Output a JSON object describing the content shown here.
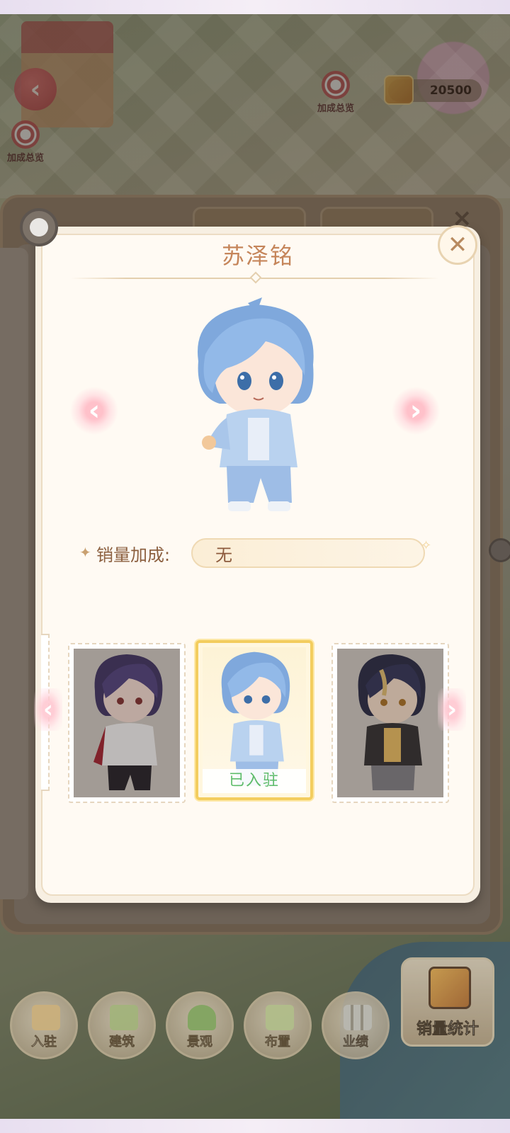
{
  "hud": {
    "bonus_overview_label": "加成总览",
    "bonus_overview_label_left": "加成总览",
    "coins": "20500"
  },
  "popup": {
    "title": "苏泽铭",
    "sales_bonus_label": "销量加成:",
    "sales_bonus_value": "无"
  },
  "cards": [
    {
      "name": "character-card-1",
      "status": ""
    },
    {
      "name": "character-card-2",
      "status": "已入驻"
    },
    {
      "name": "character-card-3",
      "status": ""
    }
  ],
  "nav": {
    "items": [
      {
        "label": "入驻",
        "icon": "shop-icon"
      },
      {
        "label": "建筑",
        "icon": "building-icon"
      },
      {
        "label": "景观",
        "icon": "tree-icon"
      },
      {
        "label": "布置",
        "icon": "decor-icon"
      },
      {
        "label": "业绩",
        "icon": "chart-icon"
      }
    ],
    "stats_label": "销量统计"
  },
  "colors": {
    "title": "#c5855a",
    "status_green": "#5ebc6a",
    "selected_border": "#f3cd5e"
  }
}
